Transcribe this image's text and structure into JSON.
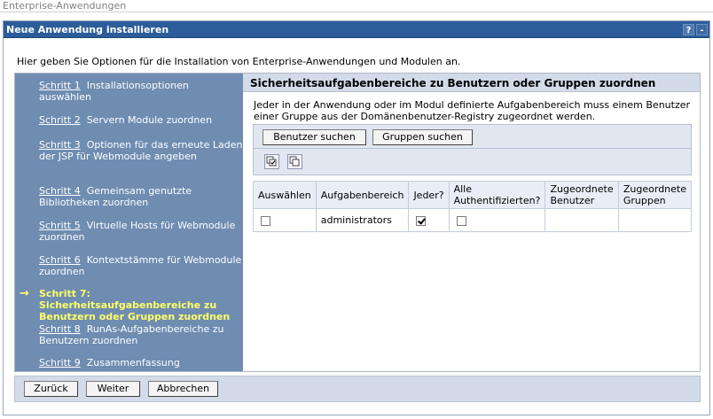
{
  "app": {
    "title": "Enterprise-Anwendungen"
  },
  "window": {
    "title": "Neue Anwendung installieren",
    "help_label": "?",
    "minimize_label": "-"
  },
  "intro": "Hier geben Sie Optionen für die Installation von Enterprise-Anwendungen und Modulen an.",
  "steps": [
    {
      "link": "Schritt 1",
      "text": "Installationsoptionen auswählen"
    },
    {
      "link": "Schritt 2",
      "text": "Servern Module zuordnen"
    },
    {
      "link": "Schritt 3",
      "text": "Optionen für das erneute Laden der JSP für Webmodule angeben"
    },
    {
      "link": "Schritt 4",
      "text": "Gemeinsam genutzte Bibliotheken zuordnen"
    },
    {
      "link": "Schritt 5",
      "text": "Virtuelle Hosts für Webmodule zuordnen"
    },
    {
      "link": "Schritt 6",
      "text": "Kontextstämme für Webmodule zuordnen"
    },
    {
      "current": true,
      "arrow": "→",
      "text": "Schritt 7: Sicherheitsaufgabenbereiche zu Benutzern oder Gruppen zuordnen"
    },
    {
      "link": "Schritt 8",
      "text": "RunAs-Aufgabenbereiche zu Benutzern zuordnen"
    },
    {
      "link": "Schritt 9",
      "text": "Zusammenfassung"
    }
  ],
  "content": {
    "title": "Sicherheitsaufgabenbereiche zu Benutzern oder Gruppen zuordnen",
    "description": "Jeder in der Anwendung oder im Modul definierte Aufgabenbereich muss einem Benutzer einer Gruppe aus der Domänenbenutzer-Registry zugeordnet werden.",
    "buttons": {
      "search_users": "Benutzer suchen",
      "search_groups": "Gruppen suchen"
    },
    "icons": [
      "select-all-icon",
      "deselect-all-icon"
    ],
    "table": {
      "headers": [
        "Auswählen",
        "Aufgabenbereich",
        "Jeder?",
        "Alle Authentifizierten?",
        "Zugeordnete Benutzer",
        "Zugeordnete Gruppen"
      ],
      "rows": [
        {
          "select": false,
          "role": "administrators",
          "everyone": true,
          "all_authenticated": false,
          "users": "",
          "groups": ""
        }
      ]
    }
  },
  "footer": {
    "back": "Zurück",
    "next": "Weiter",
    "cancel": "Abbrechen"
  },
  "colors": {
    "titlebar": "#2c5d9a",
    "steps_panel": "#6f8cb1",
    "current_step": "#ffff66",
    "header_band": "#d3dbe9"
  }
}
